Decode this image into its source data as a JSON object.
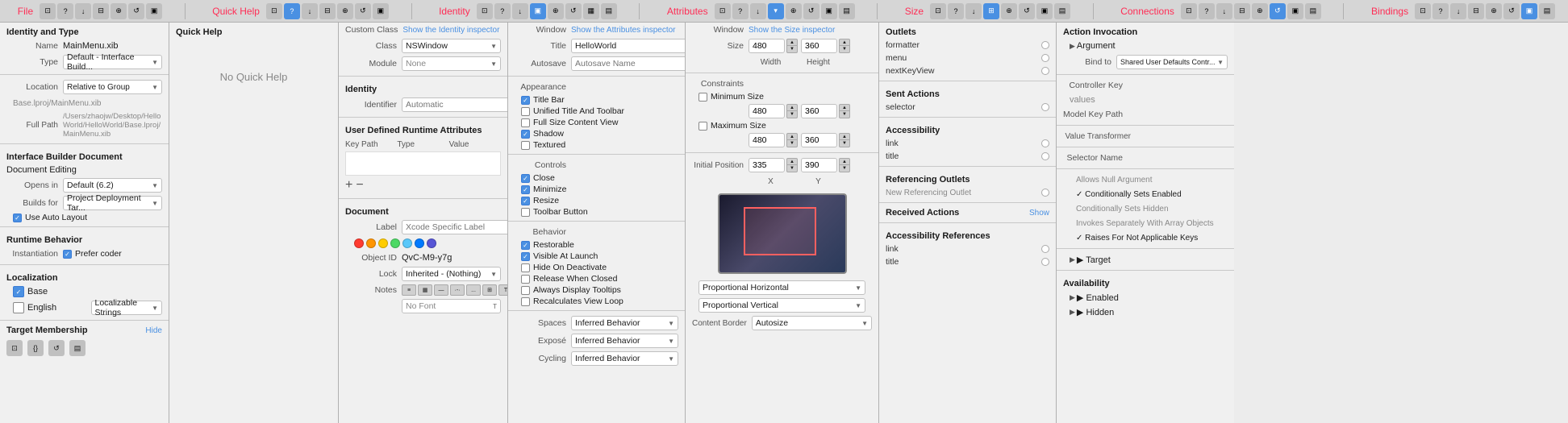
{
  "tabs": {
    "file": {
      "label": "File"
    },
    "quickhelp": {
      "label": "Quick Help"
    },
    "identity": {
      "label": "Identity"
    },
    "attributes": {
      "label": "Attributes"
    },
    "size": {
      "label": "Size"
    },
    "connections": {
      "label": "Connections"
    },
    "bindings": {
      "label": "Bindings"
    }
  },
  "file_panel": {
    "title": "Identity and Type",
    "name_label": "Name",
    "name_value": "MainMenu.xib",
    "type_label": "Type",
    "type_value": "Default - Interface Build...",
    "location_label": "Location",
    "location_value": "Relative to Group",
    "base_path": "Base.lproj/MainMenu.xib",
    "full_path_label": "Full Path",
    "full_path_value": "/Users/zhaojw/Desktop/HelloWorld/HelloWorld/Base.lproj/MainMenu.xib",
    "ib_document": "Interface Builder Document",
    "document_editing": "Document Editing",
    "opens_in_label": "Opens in",
    "opens_in_value": "Default (6.2)",
    "builds_for_label": "Builds for",
    "builds_for_value": "Project Deployment Tar...",
    "use_auto_layout": "Use Auto Layout",
    "runtime_behavior": "Runtime Behavior",
    "instantiation_label": "Instantiation",
    "prefer_coder": "Prefer coder",
    "localization": "Localization",
    "base_item": "Base",
    "english_item": "English",
    "localizable_strings": "Localizable Strings",
    "target_membership": "Target Membership",
    "hide": "Hide"
  },
  "quickhelp_panel": {
    "title": "Quick Help",
    "no_help": "No Quick Help"
  },
  "identity_panel": {
    "custom_class_label": "Custom Class",
    "show_identity": "Show the Identity inspector",
    "class_label": "Class",
    "class_value": "NSWindow",
    "module_label": "Module",
    "module_value": "None",
    "identity_title": "Identity",
    "identifier_label": "Identifier",
    "identifier_placeholder": "Automatic",
    "user_defined_title": "User Defined Runtime Attributes",
    "key_path_col": "Key Path",
    "type_col": "Type",
    "value_col": "Value",
    "plus": "+",
    "minus": "−",
    "document_title": "Document",
    "label_label": "Label",
    "label_placeholder": "Xcode Specific Label",
    "color_dots": [
      "#ff3b30",
      "#ff9500",
      "#ffcc00",
      "#4cd964",
      "#5ac8fa",
      "#007aff",
      "#5856d6"
    ],
    "object_id_label": "Object ID",
    "object_id_value": "QvC-M9-y7g",
    "lock_label": "Lock",
    "lock_value": "Inherited - (Nothing)",
    "notes_label": "Notes",
    "no_font": "No Font"
  },
  "attributes_panel": {
    "window_label": "Window",
    "show_attributes": "Show the Attributes inspector",
    "title_label": "Title",
    "title_value": "HelloWorld",
    "autosave_label": "Autosave",
    "autosave_placeholder": "Autosave Name",
    "appearance_label": "Appearance",
    "checkboxes": [
      {
        "label": "Title Bar",
        "checked": true
      },
      {
        "label": "Unified Title And Toolbar",
        "checked": false
      },
      {
        "label": "Full Size Content View",
        "checked": false
      },
      {
        "label": "Shadow",
        "checked": true
      },
      {
        "label": "Textured",
        "checked": false
      }
    ],
    "controls_label": "Controls",
    "control_checks": [
      {
        "label": "Close",
        "checked": true
      },
      {
        "label": "Minimize",
        "checked": true
      },
      {
        "label": "Resize",
        "checked": true
      },
      {
        "label": "Toolbar Button",
        "checked": false
      }
    ],
    "behavior_label": "Behavior",
    "behavior_checks": [
      {
        "label": "Restorable",
        "checked": true
      },
      {
        "label": "Visible At Launch",
        "checked": true
      },
      {
        "label": "Hide On Deactivate",
        "checked": false
      },
      {
        "label": "Release When Closed",
        "checked": false
      },
      {
        "label": "Always Display Tooltips",
        "checked": false
      },
      {
        "label": "Recalculates View Loop",
        "checked": false
      }
    ],
    "spaces_label": "Spaces",
    "spaces_value": "Inferred Behavior",
    "expose_label": "Exposé",
    "expose_value": "Inferred Behavior",
    "cycling_label": "Cycling",
    "cycling_value": "Inferred Behavior"
  },
  "size_panel": {
    "window_label": "Window",
    "show_size": "Show the Size inspector",
    "size_label": "Size",
    "width_value": "480",
    "height_value": "360",
    "width_label": "Width",
    "height_label": "Height",
    "constraints_label": "Constraints",
    "min_size_label": "Minimum Size",
    "min_width": "480",
    "min_height": "360",
    "max_size_label": "Maximum Size",
    "max_width": "480",
    "max_height": "360",
    "initial_position_label": "Initial Position",
    "x_value": "335",
    "y_value": "390",
    "x_label": "X",
    "y_label": "Y",
    "prop_horizontal": "Proportional Horizontal",
    "prop_vertical": "Proportional Vertical",
    "content_border_label": "Content Border",
    "content_border_value": "Autosize"
  },
  "connections_panel": {
    "outlets_title": "Outlets",
    "formatter": "formatter",
    "menu": "menu",
    "next_key_view": "nextKeyView",
    "sent_actions_title": "Sent Actions",
    "selector": "selector",
    "accessibility_title": "Accessibility",
    "acc_link": "link",
    "acc_title": "title",
    "referencing_outlets_title": "Referencing Outlets",
    "new_ref_outlet": "New Referencing Outlet",
    "received_actions_title": "Received Actions",
    "show": "Show",
    "acc_refs_title": "Accessibility References",
    "acc_refs_link": "link",
    "acc_refs_title2": "title"
  },
  "bindings_panel": {
    "action_invocation": "Action Invocation",
    "argument_label": "▶ Argument",
    "bind_to_label": "Bind to",
    "bind_to_value": "Shared User Defaults Contr...",
    "controller_key": "Controller Key",
    "values_label": "values",
    "model_key_path": "Model Key Path",
    "value_transformer": "Value Transformer",
    "selector_name": "Selector Name",
    "allows_null": "Allows Null Argument",
    "conditionally_enabled": "✓ Conditionally Sets Enabled",
    "conditionally_hidden": "Conditionally Sets Hidden",
    "invokes_separately": "Invokes Separately With Array Objects",
    "raises_not_applicable": "✓ Raises For Not Applicable Keys",
    "target_label": "▶ Target",
    "availability": "Availability",
    "enabled_label": "▶ Enabled",
    "hidden_label": "▶ Hidden"
  }
}
